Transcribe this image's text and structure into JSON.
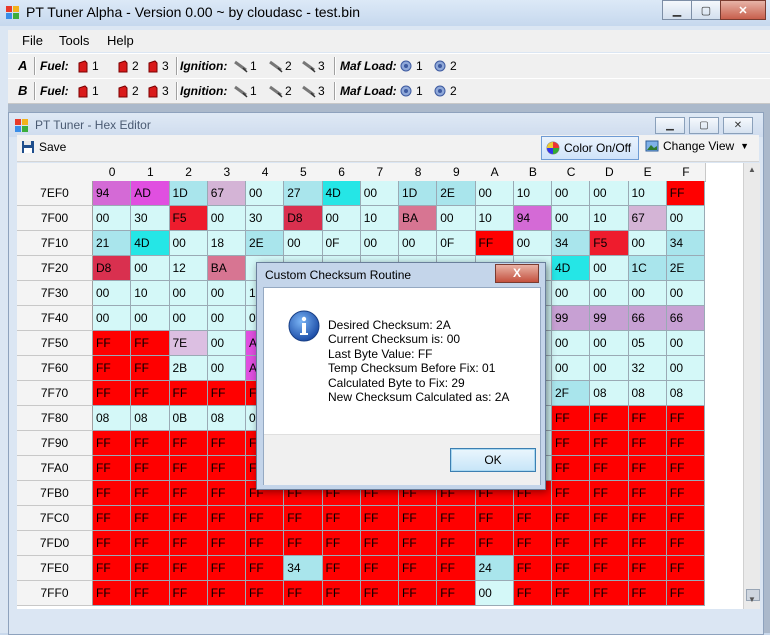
{
  "window": {
    "title": "PT Tuner Alpha - Version 0.00 ~ by cloudasc - test.bin"
  },
  "menu": [
    "File",
    "Tools",
    "Help"
  ],
  "toolbar_rows": [
    {
      "letter": "A",
      "fuel_label": "Fuel:",
      "ignition_label": "Ignition:",
      "maf_label": "Maf Load:",
      "fuel": [
        "1",
        "2",
        "3"
      ],
      "ignition": [
        "1",
        "2",
        "3"
      ],
      "maf": [
        "1",
        "2"
      ]
    },
    {
      "letter": "B",
      "fuel_label": "Fuel:",
      "ignition_label": "Ignition:",
      "maf_label": "Maf Load:",
      "fuel": [
        "1",
        "2",
        "3"
      ],
      "ignition": [
        "1",
        "2",
        "3"
      ],
      "maf": [
        "1",
        "2"
      ]
    }
  ],
  "hex_editor": {
    "title": "PT Tuner - Hex Editor",
    "save_label": "Save",
    "color_toggle_label": "Color On/Off",
    "change_view_label": "Change View",
    "columns": [
      "0",
      "1",
      "2",
      "3",
      "4",
      "5",
      "6",
      "7",
      "8",
      "9",
      "A",
      "B",
      "C",
      "D",
      "E",
      "F"
    ],
    "rows": [
      {
        "addr": "7EF0",
        "cells": [
          "94",
          "AD",
          "1D",
          "67",
          "00",
          "27",
          "4D",
          "00",
          "1D",
          "2E",
          "00",
          "10",
          "00",
          "00",
          "10",
          "FF"
        ]
      },
      {
        "addr": "7F00",
        "cells": [
          "00",
          "30",
          "F5",
          "00",
          "30",
          "D8",
          "00",
          "10",
          "BA",
          "00",
          "10",
          "94",
          "00",
          "10",
          "67",
          "00"
        ]
      },
      {
        "addr": "7F10",
        "cells": [
          "21",
          "4D",
          "00",
          "18",
          "2E",
          "00",
          "0F",
          "00",
          "00",
          "0F",
          "FF",
          "00",
          "34",
          "F5",
          "00",
          "34"
        ]
      },
      {
        "addr": "7F20",
        "cells": [
          "D8",
          "00",
          "12",
          "BA",
          "",
          "",
          "",
          "",
          "",
          "",
          "",
          "",
          "4D",
          "00",
          "1C",
          "2E"
        ]
      },
      {
        "addr": "7F30",
        "cells": [
          "00",
          "10",
          "00",
          "00",
          "10",
          "",
          "",
          "",
          "",
          "",
          "",
          "",
          "00",
          "00",
          "00",
          "00"
        ]
      },
      {
        "addr": "7F40",
        "cells": [
          "00",
          "00",
          "00",
          "00",
          "00",
          "",
          "",
          "",
          "",
          "",
          "",
          "",
          "99",
          "99",
          "66",
          "66"
        ]
      },
      {
        "addr": "7F50",
        "cells": [
          "FF",
          "FF",
          "7E",
          "00",
          "AB",
          "",
          "",
          "",
          "",
          "",
          "",
          "",
          "00",
          "00",
          "05",
          "00"
        ]
      },
      {
        "addr": "7F60",
        "cells": [
          "FF",
          "FF",
          "2B",
          "00",
          "AB",
          "",
          "",
          "",
          "",
          "",
          "",
          "",
          "00",
          "00",
          "32",
          "00"
        ]
      },
      {
        "addr": "7F70",
        "cells": [
          "FF",
          "FF",
          "FF",
          "FF",
          "FF",
          "",
          "",
          "",
          "",
          "",
          "",
          "",
          "2F",
          "08",
          "08",
          "08"
        ]
      },
      {
        "addr": "7F80",
        "cells": [
          "08",
          "08",
          "0B",
          "08",
          "0B",
          "",
          "",
          "",
          "",
          "",
          "",
          "",
          "FF",
          "FF",
          "FF",
          "FF"
        ]
      },
      {
        "addr": "7F90",
        "cells": [
          "FF",
          "FF",
          "FF",
          "FF",
          "FF",
          "",
          "",
          "",
          "",
          "",
          "",
          "",
          "FF",
          "FF",
          "FF",
          "FF"
        ]
      },
      {
        "addr": "7FA0",
        "cells": [
          "FF",
          "FF",
          "FF",
          "FF",
          "FF",
          "",
          "",
          "",
          "",
          "",
          "",
          "",
          "FF",
          "FF",
          "FF",
          "FF"
        ]
      },
      {
        "addr": "7FB0",
        "cells": [
          "FF",
          "FF",
          "FF",
          "FF",
          "FF",
          "FF",
          "FF",
          "FF",
          "FF",
          "FF",
          "FF",
          "FF",
          "FF",
          "FF",
          "FF",
          "FF"
        ]
      },
      {
        "addr": "7FC0",
        "cells": [
          "FF",
          "FF",
          "FF",
          "FF",
          "FF",
          "FF",
          "FF",
          "FF",
          "FF",
          "FF",
          "FF",
          "FF",
          "FF",
          "FF",
          "FF",
          "FF"
        ]
      },
      {
        "addr": "7FD0",
        "cells": [
          "FF",
          "FF",
          "FF",
          "FF",
          "FF",
          "FF",
          "FF",
          "FF",
          "FF",
          "FF",
          "FF",
          "FF",
          "FF",
          "FF",
          "FF",
          "FF"
        ]
      },
      {
        "addr": "7FE0",
        "cells": [
          "FF",
          "FF",
          "FF",
          "FF",
          "FF",
          "34",
          "FF",
          "FF",
          "FF",
          "FF",
          "24",
          "FF",
          "FF",
          "FF",
          "FF",
          "FF"
        ]
      },
      {
        "addr": "7FF0",
        "cells": [
          "FF",
          "FF",
          "FF",
          "FF",
          "FF",
          "FF",
          "FF",
          "FF",
          "FF",
          "FF",
          "00",
          "FF",
          "FF",
          "FF",
          "FF",
          "FF"
        ]
      }
    ],
    "cell_colors": {
      "FF": "#ff0000",
      "00": "#d4f8f8",
      "10": "#d4f8f8",
      "30": "#d4f8f8",
      "4D": "#25e6e6",
      "AD": "#e04fe0",
      "94": "#d46ad6",
      "D8": "#d9304f",
      "F5": "#ee1c2d",
      "BA": "#d77592",
      "67": "#d4b4d6",
      "7E": "#dcbfe2",
      "AB": "#e04fe0",
      "99": "#c7a0d3",
      "66": "#c7a0d3",
      "1D": "#a9e5ec",
      "2E": "#a9e5ec",
      "21": "#a9e5ec",
      "27": "#a9e5ec",
      "34": "#a9e5ec",
      "1C": "#a9e5ec",
      "2F": "#a9e5ec",
      "24": "#a9e5ec",
      "default": "#d4f8f8"
    }
  },
  "dialog": {
    "title": "Custom Checksum Routine",
    "close_label": "X",
    "lines": [
      "Desired Checksum: 2A",
      "Current Checksum is: 00",
      "Last Byte Value: FF",
      "Temp Checksum Before Fix: 01",
      "Calculated Byte to Fix: 29",
      "New Checksum Calculated as: 2A"
    ],
    "ok_label": "OK"
  }
}
